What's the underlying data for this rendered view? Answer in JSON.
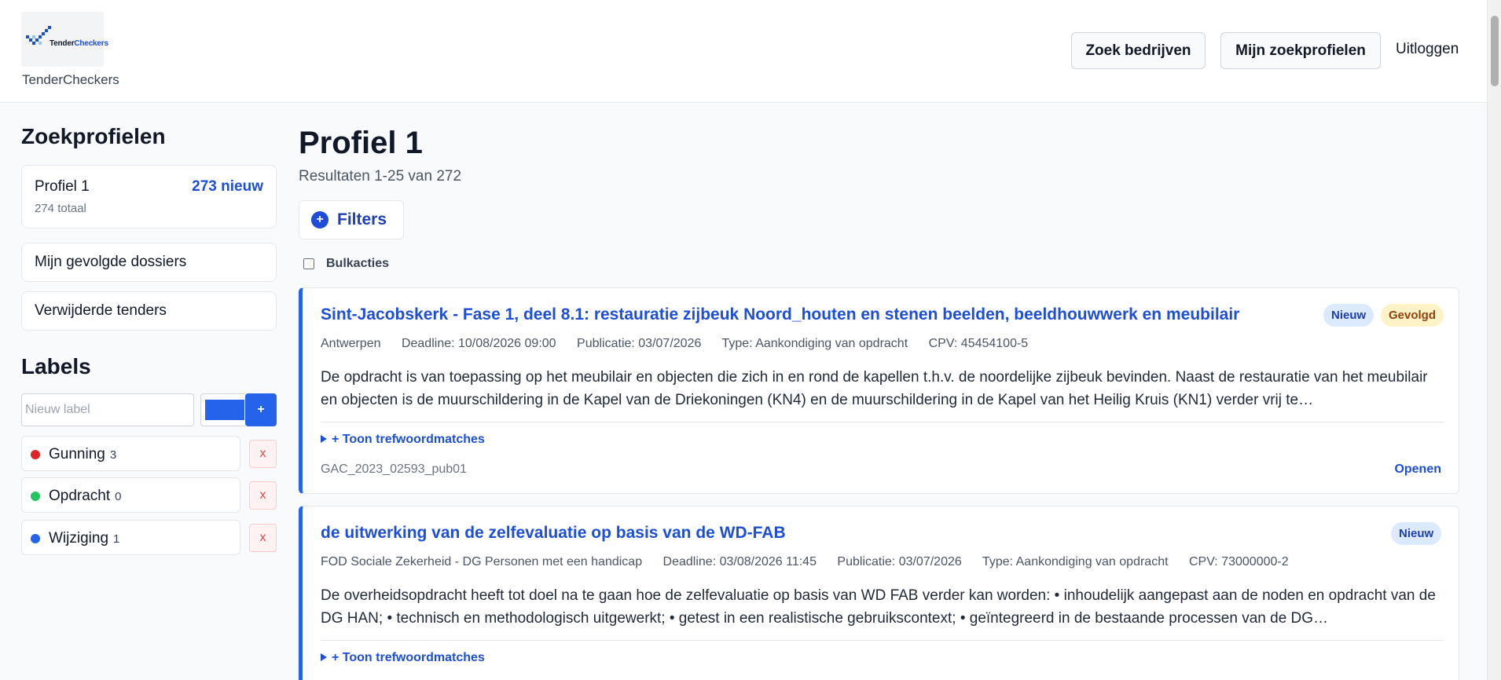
{
  "header": {
    "logo_text_a": "Tender",
    "logo_text_b": "Checkers",
    "brand": "TenderCheckers",
    "search_companies": "Zoek bedrijven",
    "my_profiles": "Mijn zoekprofielen",
    "logout": "Uitloggen"
  },
  "sidebar": {
    "profiles_heading": "Zoekprofielen",
    "profile": {
      "name": "Profiel 1",
      "new": "273 nieuw",
      "total": "274 totaal"
    },
    "links": [
      "Mijn gevolgde dossiers",
      "Verwijderde tenders"
    ],
    "labels_heading": "Labels",
    "label_input_placeholder": "Nieuw label",
    "label_color": "#2563eb",
    "add_label": "+",
    "labels": [
      {
        "name": "Gunning",
        "count": "3",
        "color": "#dc2626",
        "remove": "x"
      },
      {
        "name": "Opdracht",
        "count": "0",
        "color": "#22c55e",
        "remove": "x"
      },
      {
        "name": "Wijziging",
        "count": "1",
        "color": "#2563eb",
        "remove": "x"
      }
    ]
  },
  "main": {
    "title": "Profiel 1",
    "results": "Resultaten 1-25 van 272",
    "filters_icon": "+",
    "filters": "Filters",
    "bulk_actions": "Bulkacties",
    "tenders": [
      {
        "title": "Sint-Jacobskerk - Fase 1, deel 8.1: restauratie zijbeuk Noord_houten en stenen beelden, beeldhouwwerk en meubilair",
        "badges": [
          "Nieuw",
          "Gevolgd"
        ],
        "location": "Antwerpen",
        "deadline": "Deadline: 10/08/2026 09:00",
        "publication": "Publicatie: 03/07/2026",
        "type": "Type: Aankondiging van opdracht",
        "cpv": "CPV: 45454100-5",
        "description": "De opdracht is van toepassing op het meubilair en objecten die zich in en rond de kapellen t.h.v. de noordelijke zijbeuk bevinden. Naast de restauratie van het meubilair en objecten is de muurschildering in de Kapel van de Driekoningen (KN4) en de muurschildering in de Kapel van het Heilig Kruis (KN1) verder vrij te…",
        "matches": "+ Toon trefwoordmatches",
        "reference": "GAC_2023_02593_pub01",
        "open": "Openen"
      },
      {
        "title": "de uitwerking van de zelfevaluatie op basis van de WD-FAB",
        "badges": [
          "Nieuw"
        ],
        "location": "FOD Sociale Zekerheid - DG Personen met een handicap",
        "deadline": "Deadline: 03/08/2026 11:45",
        "publication": "Publicatie: 03/07/2026",
        "type": "Type: Aankondiging van opdracht",
        "cpv": "CPV: 73000000-2",
        "description": "De overheidsopdracht heeft tot doel na te gaan hoe de zelfevaluatie op basis van WD FAB verder kan worden: • inhoudelijk aangepast aan de noden en opdracht van de DG HAN; • technisch en methodologisch uitgewerkt; • getest in een realistische gebruikscontext; • geïntegreerd in de bestaande processen van de DG…",
        "matches": "+ Toon trefwoordmatches"
      }
    ]
  }
}
